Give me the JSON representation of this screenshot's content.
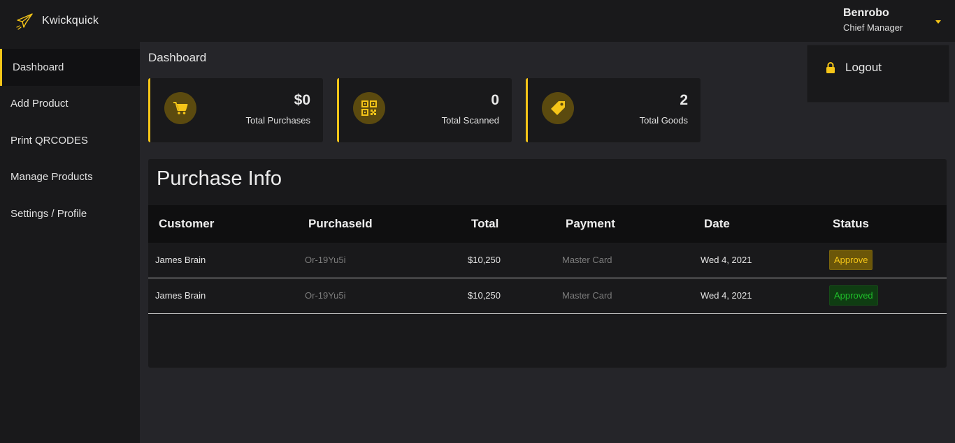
{
  "colors": {
    "accent": "#f5c518",
    "sidebar_bg": "#19191b",
    "page_bg": "#252529",
    "approve_bg": "#6b5609",
    "approved_bg": "#0f3d12",
    "approved_text": "#1fbe2a"
  },
  "brand": {
    "name": "Kwickquick",
    "icon": "paper-plane-icon"
  },
  "sidebar": {
    "items": [
      {
        "label": "Dashboard",
        "active": true
      },
      {
        "label": "Add Product"
      },
      {
        "label": "Print QRCODES"
      },
      {
        "label": "Manage Products"
      },
      {
        "label": "Settings / Profile"
      }
    ]
  },
  "user": {
    "name": "Benrobo",
    "role": "Chief Manager"
  },
  "dropdown": {
    "logout_label": "Logout",
    "icon": "lock-icon"
  },
  "page": {
    "title": "Dashboard"
  },
  "stats": [
    {
      "value": "$0",
      "label": "Total Purchases",
      "icon": "cart-icon"
    },
    {
      "value": "0",
      "label": "Total Scanned",
      "icon": "qr-code-icon"
    },
    {
      "value": "2",
      "label": "Total Goods",
      "icon": "tag-icon"
    }
  ],
  "purchase": {
    "title": "Purchase Info",
    "columns": [
      "Customer",
      "PurchaseId",
      "Total",
      "Payment",
      "Date",
      "Status"
    ],
    "rows": [
      {
        "customer": "James Brain",
        "purchase_id": "Or-19Yu5i",
        "total": "$10,250",
        "payment": "Master Card",
        "date": "Wed 4, 2021",
        "status": "Approve"
      },
      {
        "customer": "James Brain",
        "purchase_id": "Or-19Yu5i",
        "total": "$10,250",
        "payment": "Master Card",
        "date": "Wed 4, 2021",
        "status": "Approved"
      }
    ]
  }
}
